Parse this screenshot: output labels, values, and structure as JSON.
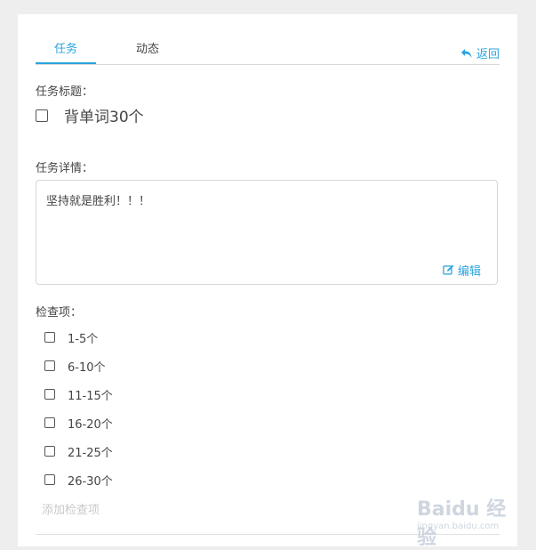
{
  "tabs": [
    {
      "label": "任务",
      "active": true
    },
    {
      "label": "动态",
      "active": false
    }
  ],
  "back_label": "返回",
  "task_title": {
    "label": "任务标题：",
    "value": "背单词30个",
    "checked": false
  },
  "task_detail": {
    "label": "任务详情：",
    "value": "坚持就是胜利！！！",
    "edit_label": "编辑"
  },
  "checklist": {
    "label": "检查项：",
    "items": [
      {
        "text": "1-5个",
        "checked": false
      },
      {
        "text": "6-10个",
        "checked": false
      },
      {
        "text": "11-15个",
        "checked": false
      },
      {
        "text": "16-20个",
        "checked": false
      },
      {
        "text": "21-25个",
        "checked": false
      },
      {
        "text": "26-30个",
        "checked": false
      }
    ],
    "add_placeholder": "添加检查项"
  },
  "watermark": {
    "logo": "Baidu 经验",
    "url": "jingyan.baidu.com"
  },
  "colors": {
    "accent": "#2aa4de",
    "background": "#eeeeee",
    "panel": "#ffffff"
  }
}
